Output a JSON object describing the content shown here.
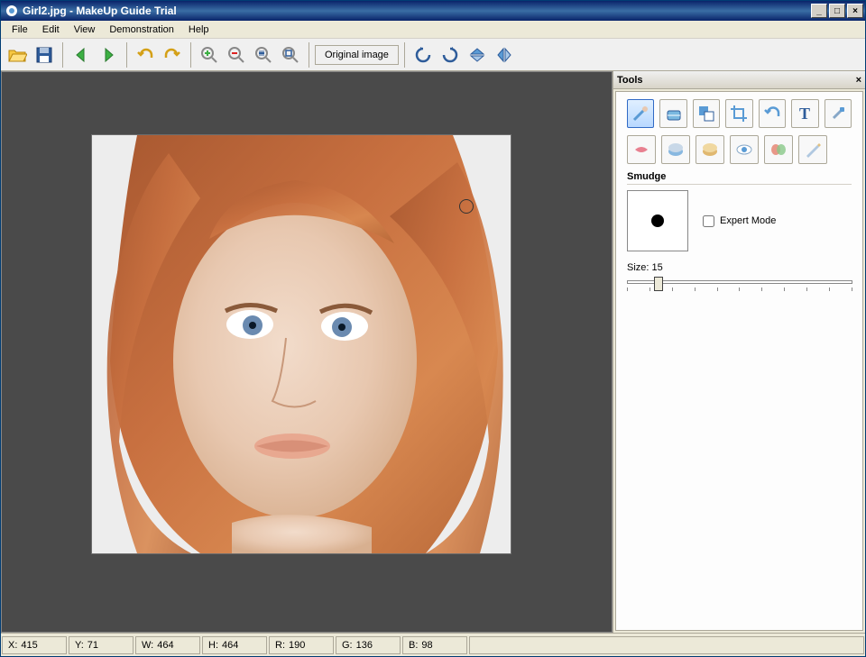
{
  "window": {
    "title": "Girl2.jpg - MakeUp Guide Trial"
  },
  "menu": {
    "items": [
      "File",
      "Edit",
      "View",
      "Demonstration",
      "Help"
    ]
  },
  "toolbar": {
    "original_label": "Original image"
  },
  "tools_panel": {
    "title": "Tools",
    "section": "Smudge",
    "expert_mode_label": "Expert Mode",
    "size_label": "Size: 15"
  },
  "status": {
    "x_label": "X:",
    "x": "415",
    "y_label": "Y:",
    "y": "71",
    "w_label": "W:",
    "w": "464",
    "h_label": "H:",
    "h": "464",
    "r_label": "R:",
    "r": "190",
    "g_label": "G:",
    "g": "136",
    "b_label": "B:",
    "b": "98"
  }
}
